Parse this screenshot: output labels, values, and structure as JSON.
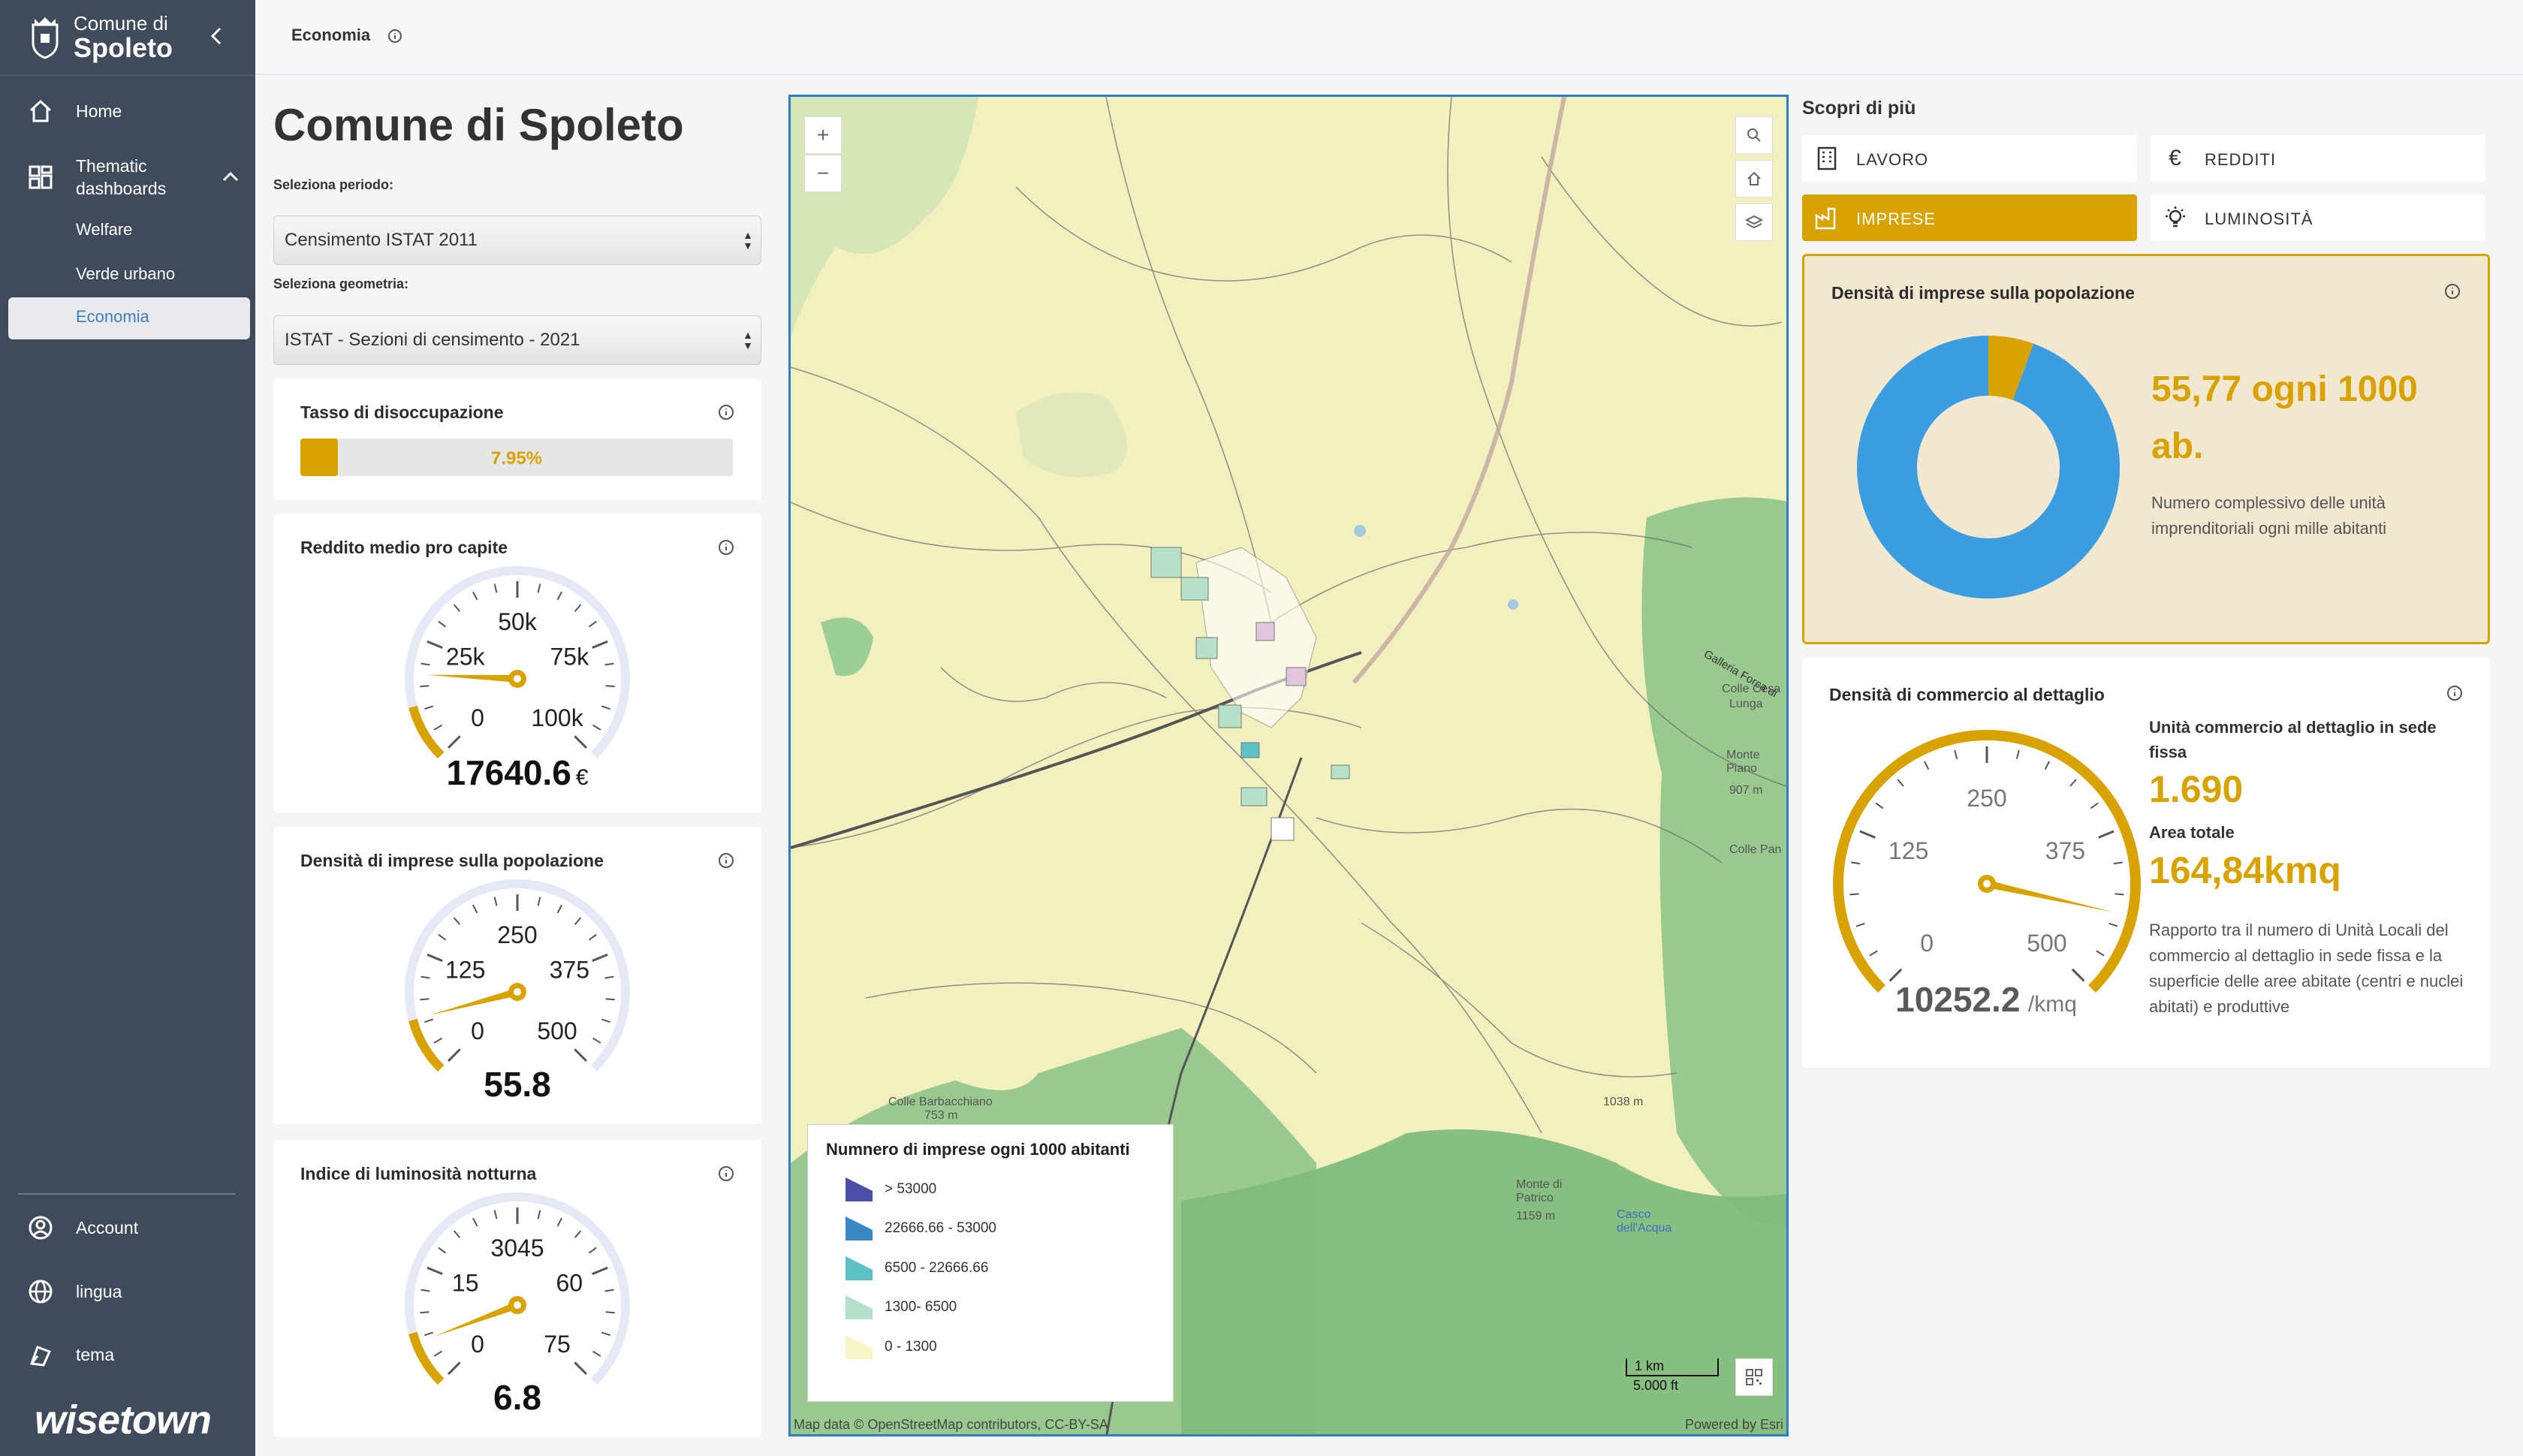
{
  "sidebar": {
    "logo_line1": "Comune di",
    "logo_line2": "Spoleto",
    "nav": {
      "home": "Home",
      "thematic": "Thematic dashboards",
      "welfare": "Welfare",
      "verde": "Verde urbano",
      "economia": "Economia",
      "account": "Account",
      "lingua": "lingua",
      "tema": "tema"
    },
    "brand": "wisetown"
  },
  "topbar": {
    "title": "Economia"
  },
  "main": {
    "page_title": "Comune di Spoleto",
    "period_label": "Seleziona periodo:",
    "period_value": "Censimento ISTAT 2011",
    "geometry_label": "Seleziona geometria:",
    "geometry_value": "ISTAT - Sezioni di censimento - 2021"
  },
  "cards": {
    "unemployment": {
      "title": "Tasso di disoccupazione",
      "value_text": "7.95%",
      "fraction": 0.0795
    },
    "income": {
      "title": "Reddito medio pro capite",
      "ticks": [
        "0",
        "25k",
        "50k",
        "75k",
        "100k"
      ],
      "value": "17640.6",
      "unit": "€",
      "fraction": 0.176
    },
    "business_density": {
      "title": "Densità di imprese sulla popolazione",
      "ticks": [
        "0",
        "125",
        "250",
        "375",
        "500"
      ],
      "value": "55.8",
      "fraction": 0.112
    },
    "luminosity": {
      "title": "Indice di luminosità notturna",
      "ticks": [
        "0",
        "15",
        "3045",
        "60",
        "75"
      ],
      "value": "6.8",
      "fraction": 0.09
    }
  },
  "map": {
    "legend_title": "Numnero di imprese ogni 1000 abitanti",
    "legend": [
      {
        "label": "> 53000",
        "color": "#4b4fa6"
      },
      {
        "label": "22666.66 - 53000",
        "color": "#3a88c4"
      },
      {
        "label": "6500 - 22666.66",
        "color": "#5cc1c6"
      },
      {
        "label": "1300- 6500",
        "color": "#b4e1c7"
      },
      {
        "label": "0 - 1300",
        "color": "#f6f5c6"
      }
    ],
    "scale_km": "1 km",
    "scale_ft": "5.000 ft",
    "attribution_left": "Map data © OpenStreetMap contributors, CC-BY-SA",
    "attribution_right": "Powered by Esri",
    "places": [
      "Colle Barbacchiano",
      "753 m",
      "Monte di Patrico",
      "1159 m",
      "Casco dell'Acqua",
      "Colle Cesa",
      "Lunga",
      "Monte Piano",
      "907 m",
      "Colle Pan",
      "1038 m",
      "Galleria Forca di"
    ]
  },
  "right": {
    "discover_title": "Scopri di più",
    "tiles": [
      "LAVORO",
      "REDDITI",
      "IMPRESE",
      "LUMINOSITÀ"
    ],
    "density_card": {
      "title": "Densità di imprese sulla popolazione",
      "value": "55,77 ogni 1000 ab.",
      "description": "Numero complessivo delle unità imprenditoriali ogni mille abitanti",
      "share": 0.0558
    },
    "commerce_card": {
      "title": "Densità di commercio al dettaglio",
      "ticks": [
        "0",
        "125",
        "250",
        "375",
        "500"
      ],
      "gauge_value": "10252.2",
      "gauge_unit": "/kmq",
      "fraction": 0.88,
      "units_label": "Unità commercio al dettaglio in sede fissa",
      "units_value": "1.690",
      "area_label": "Area totale",
      "area_value": "164,84kmq",
      "description": "Rapporto tra il numero di Unità Locali del commercio al dettaglio in sede fissa e la superficie delle aree abitate (centri e nuclei abitati) e produttive"
    }
  },
  "colors": {
    "accent": "#d8a200",
    "sidebar": "#3f4b5a",
    "donut_blue": "#3b9de0",
    "map_border": "#2e7dc7"
  }
}
